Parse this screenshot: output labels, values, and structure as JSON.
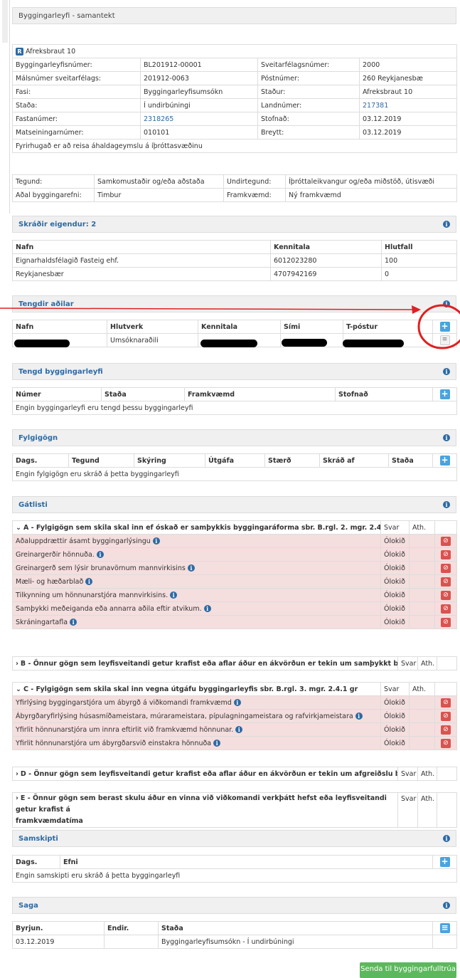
{
  "summary": {
    "title": "Byggingarleyfi - samantekt"
  },
  "property": {
    "badge": "R",
    "name": "Afreksbraut 10",
    "rows": [
      [
        "Byggingarleyfisnúmer:",
        "BL201912-00001",
        "Sveitarfélagsnúmer:",
        "2000"
      ],
      [
        "Málsnúmer sveitarfélags:",
        "201912-0063",
        "Póstnúmer:",
        "260  Reykjanesbæ"
      ],
      [
        "Fasi:",
        "Byggingarleyfisumsókn",
        "Staður:",
        "Afreksbraut 10"
      ],
      [
        "Staða:",
        "Í undirbúningi",
        "Landnúmer:",
        "217381"
      ],
      [
        "Fastanúmer:",
        "2318265",
        "Stofnað:",
        "03.12.2019"
      ],
      [
        "Matseiningarnúmer:",
        "010101",
        "Breytt:",
        "03.12.2019"
      ]
    ],
    "description": "Fyrirhugað er að reisa áhaldageymslu á íþróttasvæðinu"
  },
  "details": {
    "rows": [
      [
        "Tegund:",
        "Samkomustaðir og/eða aðstaða",
        "Undirtegund:",
        "Íþróttaleikvangur og/eða miðstöð, útisvæði"
      ],
      [
        "Aðal byggingarefni:",
        "Timbur",
        "Framkvæmd:",
        "Ný framkvæmd"
      ]
    ]
  },
  "owners": {
    "title": "Skráðir eigendur: 2",
    "headers": [
      "Nafn",
      "Kennitala",
      "Hlutfall"
    ],
    "rows": [
      [
        "Eignarhaldsfélagið Fasteig ehf.",
        "6012023280",
        "100"
      ],
      [
        "Reykjanesbær",
        "4707942169",
        "0"
      ]
    ]
  },
  "parties": {
    "title": "Tengdir aðilar",
    "headers": [
      "Nafn",
      "Hlutverk",
      "Kennitala",
      "Sími",
      "T-póstur"
    ],
    "rows": [
      [
        "",
        "Umsóknaraðili",
        "",
        "",
        ""
      ]
    ]
  },
  "permits": {
    "title": "Tengd byggingarleyfi",
    "headers": [
      "Númer",
      "Staða",
      "Framkvæmd",
      "Stofnað"
    ],
    "empty": "Engin byggingarleyfi eru tengd þessu byggingarleyfi"
  },
  "attachments": {
    "title": "Fylgigögn",
    "headers": [
      "Dags.",
      "Tegund",
      "Skýring",
      "Útgáfa",
      "Stærð",
      "Skráð af",
      "Staða"
    ],
    "empty": "Engin fylgigögn eru skráð á þetta byggingarleyfi"
  },
  "checklist": {
    "title": "Gátlisti",
    "answer_label": "Svar",
    "note_label": "Ath.",
    "status": "Ólokið",
    "groupA": {
      "label": "A - Fylgigögn sem skila skal inn ef óskað er samþykkis byggingaráforma sbr. B.rgl. 2. mgr. 2.4.1 gr.",
      "items": [
        "Aðaluppdrættir ásamt byggingarlýsingu",
        "Greinargerðir hönnuða.",
        "Greinargerð sem lýsir brunavörnum mannvirkisins",
        "Mæli- og hæðarblað",
        "Tilkynning um hönnunarstjóra mannvirkisins.",
        "Samþykki meðeiganda eða annarra aðila eftir atvikum.",
        "Skráningartafla"
      ]
    },
    "groupB": {
      "label": "B - Önnur gögn sem leyfisveitandi getur krafist eða aflar áður en ákvörðun er tekin um samþykkt byggingaráforma"
    },
    "groupC": {
      "label": "C - Fylgigögn sem skila skal inn vegna útgáfu byggingarleyfis sbr. B.rgl. 3. mgr. 2.4.1 gr",
      "items": [
        "Yfirlýsing byggingarstjóra um ábyrgð á viðkomandi framkvæmd",
        "Ábyrgðaryfirlýsing húsasmíðameistara, múrarameistara, pípulagningameistara og rafvirkjameistara",
        "Yfirlit hönnunarstjóra um innra eftirlit við framkvæmd hönnunar.",
        "Yfirlit hönnunarstjóra um ábyrgðarsvið einstakra hönnuða"
      ]
    },
    "groupD": {
      "label": "D - Önnur gögn sem leyfisveitandi getur krafist eða aflar áður en ákvörðun er tekin um afgreiðslu byggingarleyfis"
    },
    "groupE": {
      "label_line1": "E - Önnur gögn sem berast skulu áður en vinna við viðkomandi verkþátt hefst eða leyfisveitandi getur krafist á",
      "label_line2": "framkvæmdatíma"
    }
  },
  "communications": {
    "title": "Samskipti",
    "headers": [
      "Dags.",
      "Efni"
    ],
    "empty": "Engin samskipti eru skráð á þetta byggingarleyfi"
  },
  "history": {
    "title": "Saga",
    "headers": [
      "Byrjun.",
      "Endir.",
      "Staða"
    ],
    "rows": [
      [
        "03.12.2019",
        "",
        "Byggingarleyfisumsókn - Í undirbúningi"
      ]
    ]
  },
  "actions": {
    "send_label": "Senda til byggingarfulltrúa"
  },
  "icons": {
    "info": "info-icon",
    "add": "plus-icon",
    "remove": "ban-icon",
    "menu": "menu-icon"
  },
  "colors": {
    "link": "#2d6aa3",
    "add": "#4aa3df",
    "remove": "#d9534f",
    "send": "#5cb85c",
    "unfinished_row": "#f5dede",
    "annotation": "#e02020"
  }
}
